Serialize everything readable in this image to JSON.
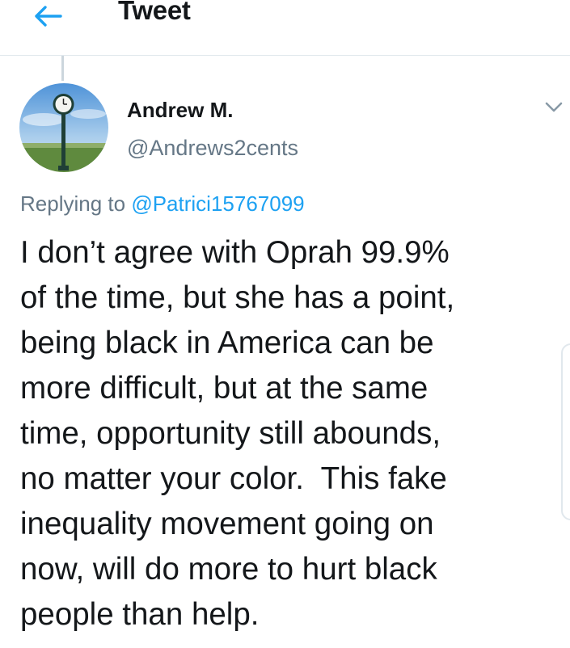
{
  "header": {
    "back_icon": "arrow-left-icon",
    "title": "Tweet"
  },
  "tweet": {
    "author": {
      "display_name": "Andrew M.",
      "handle": "@Andrews2cents",
      "avatar": "avatar-clock-tower-photo"
    },
    "menu_icon": "chevron-down-icon",
    "replying_prefix": "Replying to",
    "replying_to": "@Patrici15767099",
    "text_lines": [
      "I don’t agree with Oprah 99.9%",
      "of the time, but she has a point,",
      "being black in America can be",
      "more difficult, but at the same",
      "time, opportunity still abounds,",
      "no matter your color.  This fake",
      "inequality movement going on",
      "now, will do more to hurt black",
      "people than help."
    ]
  },
  "colors": {
    "accent": "#1da1f2",
    "text_primary": "#14171a",
    "text_secondary": "#657786",
    "divider": "#e1e8ed"
  }
}
